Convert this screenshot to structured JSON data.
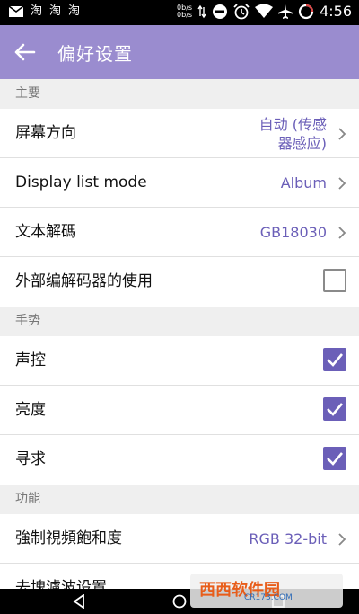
{
  "status_bar": {
    "net_up": "0b/s",
    "net_down": "0b/s",
    "time": "4:56",
    "left_icons": [
      "mail-icon",
      "taobao-icon",
      "taobao-icon",
      "taobao-icon"
    ],
    "right_icons": [
      "data-arrows-icon",
      "do-not-disturb-icon",
      "alarm-icon",
      "wifi-icon",
      "airplane-icon",
      "battery-icon"
    ],
    "left_glyphs": [
      "淘",
      "淘",
      "淘"
    ]
  },
  "appbar": {
    "title": "偏好设置"
  },
  "sections": {
    "main": {
      "header": "主要",
      "orientation": {
        "label": "屏幕方向",
        "value_line1": "自动 (传感",
        "value_line2": "器感应)"
      },
      "display_list": {
        "label": "Display list mode",
        "value": "Album"
      },
      "text_decode": {
        "label": "文本解碼",
        "value": "GB18030"
      },
      "external_decoder": {
        "label": "外部编解码器的使用",
        "checked": false
      }
    },
    "gestures": {
      "header": "手势",
      "voice": {
        "label": "声控",
        "checked": true
      },
      "brightness": {
        "label": "亮度",
        "checked": true
      },
      "seek": {
        "label": "寻求",
        "checked": true
      }
    },
    "functions": {
      "header": "功能",
      "force_saturation": {
        "label": "強制視頻飽和度",
        "value": "RGB 32-bit"
      },
      "partial_next": {
        "label": "去塊濾波设置"
      }
    }
  },
  "watermark": {
    "brand": "西西软件园",
    "url": "CR173.COM"
  },
  "colors": {
    "accent": "#6b5fb8",
    "appbar": "#9a8ccf",
    "background": "#efefef"
  }
}
